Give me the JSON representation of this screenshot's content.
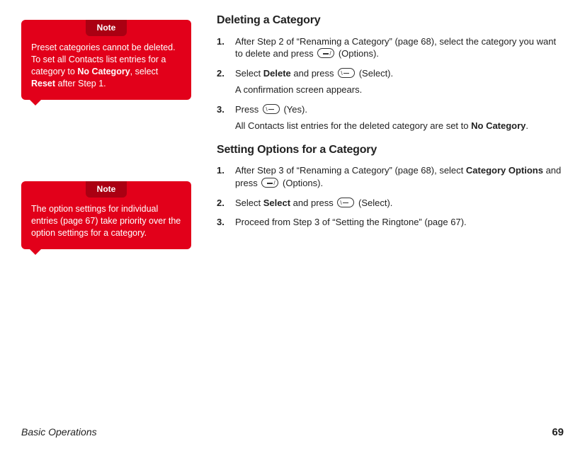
{
  "notes": [
    {
      "title": "Note",
      "body_parts": [
        "Preset categories cannot be deleted. To set all Contacts list entries for a category to ",
        "No Category",
        ", select ",
        "Reset",
        " after Step 1."
      ]
    },
    {
      "title": "Note",
      "body_parts": [
        "The option settings for individual entries (page 67) take priority over the option settings for a category."
      ]
    }
  ],
  "sections": [
    {
      "heading": "Deleting a Category",
      "steps": [
        {
          "parts": [
            {
              "t": "After Step 2 of “Renaming a Category” (page 68), select the category you want to delete and press "
            },
            {
              "key": "left"
            },
            {
              "t": " (Options)."
            }
          ]
        },
        {
          "parts": [
            {
              "t": "Select "
            },
            {
              "b": "Delete"
            },
            {
              "t": " and press "
            },
            {
              "key": "right"
            },
            {
              "t": " (Select)."
            }
          ],
          "sub": [
            {
              "t": "A confirmation screen appears."
            }
          ]
        },
        {
          "parts": [
            {
              "t": "Press "
            },
            {
              "key": "right"
            },
            {
              "t": " (Yes)."
            }
          ],
          "sub": [
            {
              "t": "All Contacts list entries for the deleted category are set to "
            },
            {
              "b": "No Category"
            },
            {
              "t": "."
            }
          ]
        }
      ]
    },
    {
      "heading": "Setting Options for a Category",
      "steps": [
        {
          "parts": [
            {
              "t": "After Step 3 of “Renaming a Category” (page 68), select "
            },
            {
              "b": "Category Options"
            },
            {
              "t": " and press "
            },
            {
              "key": "left"
            },
            {
              "t": " (Options)."
            }
          ]
        },
        {
          "parts": [
            {
              "t": "Select "
            },
            {
              "b": "Select"
            },
            {
              "t": " and press "
            },
            {
              "key": "right"
            },
            {
              "t": " (Select)."
            }
          ]
        },
        {
          "parts": [
            {
              "t": "Proceed from Step 3 of “Setting the Ringtone” (page 67)."
            }
          ]
        }
      ]
    }
  ],
  "footer": {
    "section": "Basic Operations",
    "page": "69"
  }
}
